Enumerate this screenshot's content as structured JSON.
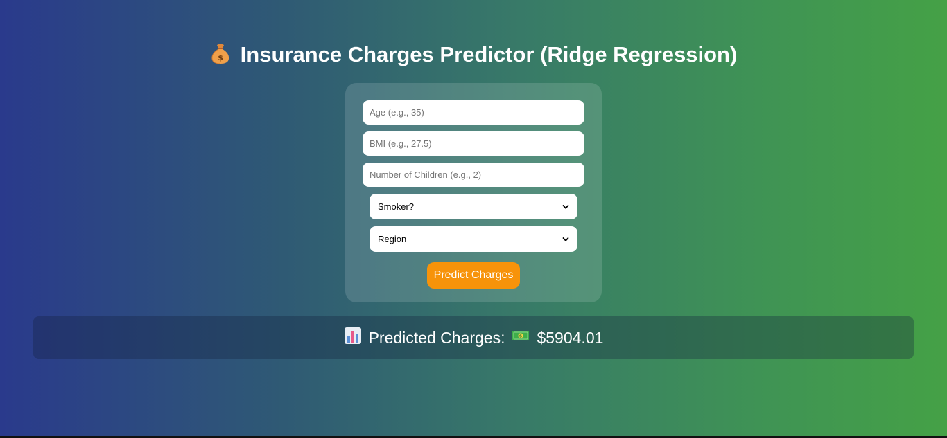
{
  "header": {
    "icon": "money-bag-icon",
    "title": "Insurance Charges Predictor (Ridge Regression)"
  },
  "form": {
    "age_placeholder": "Age (e.g., 35)",
    "bmi_placeholder": "BMI (e.g., 27.5)",
    "children_placeholder": "Number of Children (e.g., 2)",
    "smoker_select": "Smoker?",
    "region_select": "Region",
    "predict_label": "Predict Charges"
  },
  "result": {
    "chart_icon": "bar-chart-icon",
    "label": "Predicted Charges:",
    "money_icon": "dollar-bill-icon",
    "value": "$5904.01"
  },
  "colors": {
    "gradient_start": "#2a3a8c",
    "gradient_end": "#45a146",
    "button": "#f7930a"
  }
}
